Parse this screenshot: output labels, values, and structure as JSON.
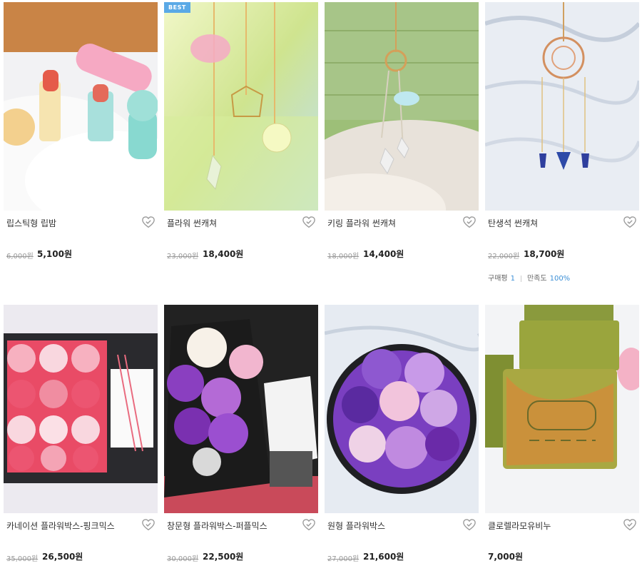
{
  "products": [
    {
      "name": "립스틱형 립밤",
      "original_price": "6,000원",
      "sale_price": "5,100원",
      "badge": "",
      "image": "lipstick-lip-balm-photo"
    },
    {
      "name": "플라워 썬캐쳐",
      "original_price": "23,000원",
      "sale_price": "18,400원",
      "badge": "BEST",
      "image": "flower-suncatcher-photo"
    },
    {
      "name": "키링 플라워 썬캐쳐",
      "original_price": "18,000원",
      "sale_price": "14,400원",
      "badge": "",
      "image": "keyring-suncatcher-photo"
    },
    {
      "name": "탄생석 썬캐쳐",
      "original_price": "22,000원",
      "sale_price": "18,700원",
      "badge": "",
      "image": "birthstone-suncatcher-photo",
      "review": {
        "purchase_label": "구매평",
        "purchase_count": "1",
        "satisfaction_label": "만족도",
        "satisfaction_value": "100%"
      }
    },
    {
      "name": "카네이션 플라워박스-핑크믹스",
      "original_price": "35,000원",
      "sale_price": "26,500원",
      "badge": "",
      "image": "carnation-flower-box-photo"
    },
    {
      "name": "창문형 플라워박스-퍼플믹스",
      "original_price": "30,000원",
      "sale_price": "22,500원",
      "badge": "",
      "image": "window-flower-box-photo"
    },
    {
      "name": "원형 플라워박스",
      "original_price": "27,000원",
      "sale_price": "21,600원",
      "badge": "",
      "image": "round-flower-box-photo"
    },
    {
      "name": "클로렐라모유비누",
      "original_price": "",
      "sale_price": "7,000원",
      "badge": "",
      "image": "chlorella-soap-photo"
    }
  ],
  "colors": {
    "best_badge": "#5aa9e6",
    "review_accent": "#3b8fd6"
  },
  "icons": {
    "wishlist": "heart-check-icon"
  }
}
